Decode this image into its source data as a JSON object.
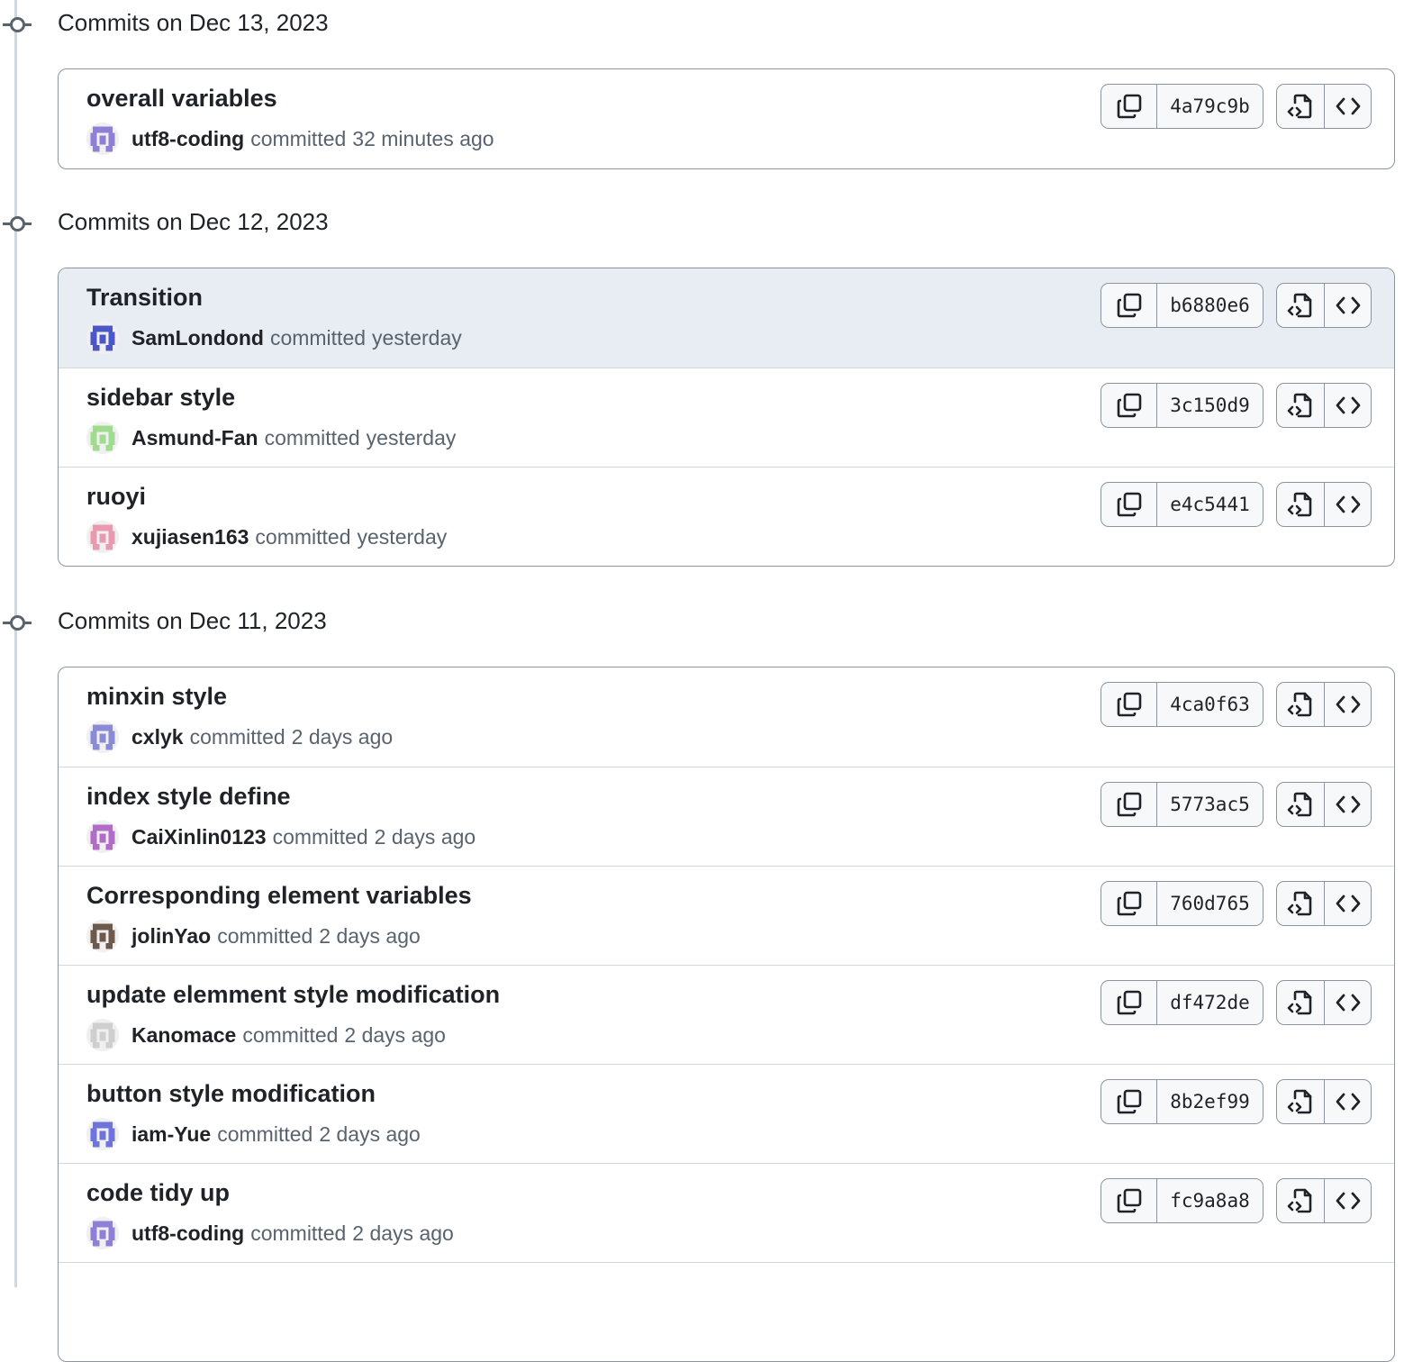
{
  "groups": [
    {
      "title": "Commits on Dec 13, 2023",
      "commits": [
        {
          "title": "overall variables",
          "author": "utf8-coding",
          "action": "committed",
          "time": "32 minutes ago",
          "sha": "4a79c9b",
          "avatar_color": "#8f7fd6"
        }
      ]
    },
    {
      "title": "Commits on Dec 12, 2023",
      "commits": [
        {
          "title": "Transition",
          "author": "SamLondond",
          "action": "committed",
          "time": "yesterday",
          "sha": "b6880e6",
          "avatar_color": "#4b57c8"
        },
        {
          "title": "sidebar style",
          "author": "Asmund-Fan",
          "action": "committed",
          "time": "yesterday",
          "sha": "3c150d9",
          "avatar_color": "#9fdc8f"
        },
        {
          "title": "ruoyi",
          "author": "xujiasen163",
          "action": "committed",
          "time": "yesterday",
          "sha": "e4c5441",
          "avatar_color": "#e79ab0"
        }
      ]
    },
    {
      "title": "Commits on Dec 11, 2023",
      "commits": [
        {
          "title": "minxin style",
          "author": "cxlyk",
          "action": "committed",
          "time": "2 days ago",
          "sha": "4ca0f63",
          "avatar_color": "#8b8ad6"
        },
        {
          "title": "index style define",
          "author": "CaiXinlin0123",
          "action": "committed",
          "time": "2 days ago",
          "sha": "5773ac5",
          "avatar_color": "#b06cc7"
        },
        {
          "title": "Corresponding element variables",
          "author": "jolinYao",
          "action": "committed",
          "time": "2 days ago",
          "sha": "760d765",
          "avatar_color": "#6d5a4c"
        },
        {
          "title": "update elemment style modification",
          "author": "Kanomace",
          "action": "committed",
          "time": "2 days ago",
          "sha": "df472de",
          "avatar_color": "#cfcfcf"
        },
        {
          "title": "button style modification",
          "author": "iam-Yue",
          "action": "committed",
          "time": "2 days ago",
          "sha": "8b2ef99",
          "avatar_color": "#6e74dc"
        },
        {
          "title": "code tidy up",
          "author": "utf8-coding",
          "action": "committed",
          "time": "2 days ago",
          "sha": "fc9a8a8",
          "avatar_color": "#8f7fd6"
        }
      ]
    }
  ],
  "icons": {
    "copy": "copy-icon",
    "browse": "file-code-icon",
    "code": "code-icon",
    "group": "git-commit-icon"
  }
}
